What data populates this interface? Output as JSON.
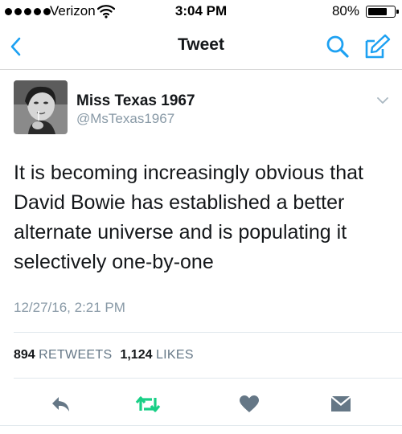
{
  "status_bar": {
    "carrier": "Verizon",
    "time": "3:04 PM",
    "battery_percent": "80%",
    "battery_level": 0.8,
    "signal_bars": 5
  },
  "nav": {
    "title": "Tweet",
    "icons": [
      "chevron-left-icon",
      "search-icon",
      "compose-icon"
    ],
    "accent_color": "#1da1f2"
  },
  "tweet": {
    "display_name": "Miss Texas 1967",
    "handle": "@MsTexas1967",
    "text": "It is becoming increasingly obvious that David Bowie has established a better alternate universe and is populating it selectively one-by-one",
    "timestamp": "12/27/16, 2:21 PM",
    "retweets_count": "894",
    "retweets_label": "RETWEETS",
    "likes_count": "1,124",
    "likes_label": "LIKES"
  },
  "actions": {
    "icons": [
      "reply-icon",
      "retweet-icon",
      "like-icon",
      "direct-message-icon"
    ],
    "retweet_color": "#19cf86",
    "default_color": "#657786"
  }
}
